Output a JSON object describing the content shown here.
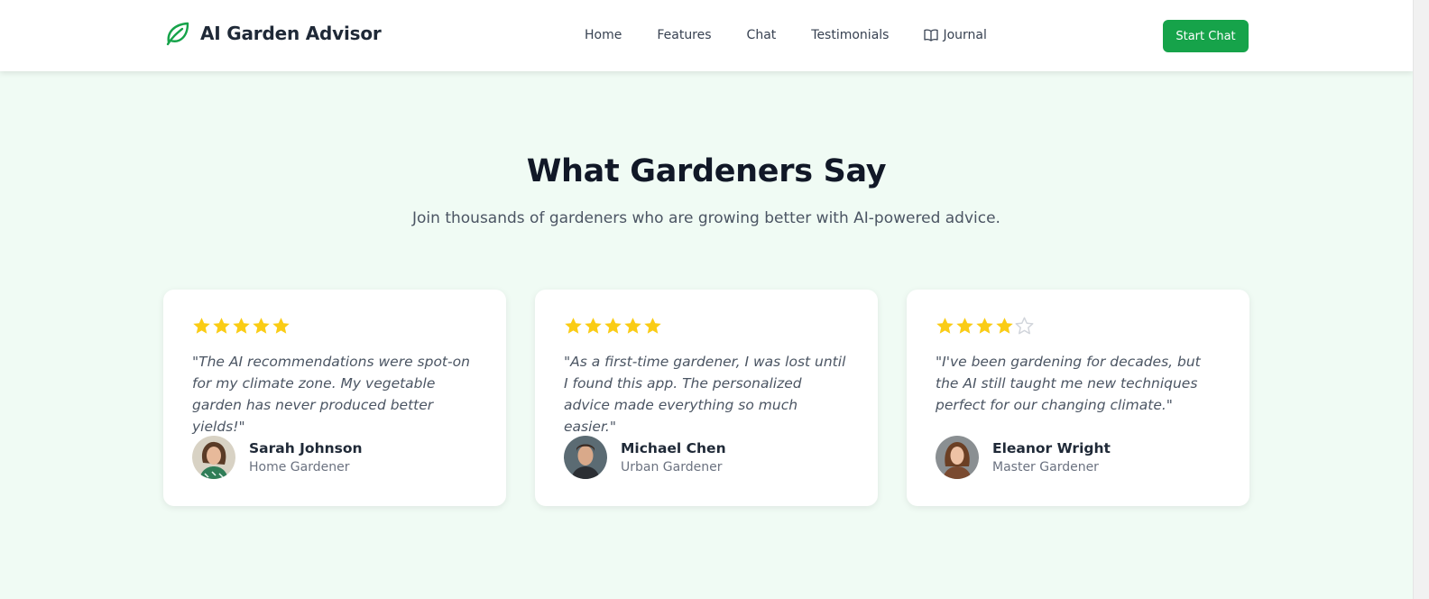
{
  "brand": {
    "name": "AI Garden Advisor",
    "icon": "leaf-icon",
    "color": "#16a34a"
  },
  "nav": {
    "links": [
      "Home",
      "Features",
      "Chat",
      "Testimonials"
    ],
    "journal": {
      "label": "Journal",
      "icon": "book-icon"
    },
    "cta": "Start Chat"
  },
  "section": {
    "title": "What Gardeners Say",
    "subtitle": "Join thousands of gardeners who are growing better with AI-powered advice."
  },
  "testimonials": [
    {
      "rating": 5,
      "quote": "\"The AI recommendations were spot-on for my climate zone. My vegetable garden has never produced better yields!\"",
      "name": "Sarah Johnson",
      "role": "Home Gardener"
    },
    {
      "rating": 5,
      "quote": "\"As a first-time gardener, I was lost until I found this app. The personalized advice made everything so much easier.\"",
      "name": "Michael Chen",
      "role": "Urban Gardener"
    },
    {
      "rating": 4,
      "quote": "\"I've been gardening for decades, but the AI still taught me new techniques perfect for our changing climate.\"",
      "name": "Eleanor Wright",
      "role": "Master Gardener"
    }
  ],
  "colors": {
    "accent": "#16a34a",
    "star_filled": "#facc15",
    "star_empty": "#d1d5db",
    "background": "#f0fbf4"
  }
}
